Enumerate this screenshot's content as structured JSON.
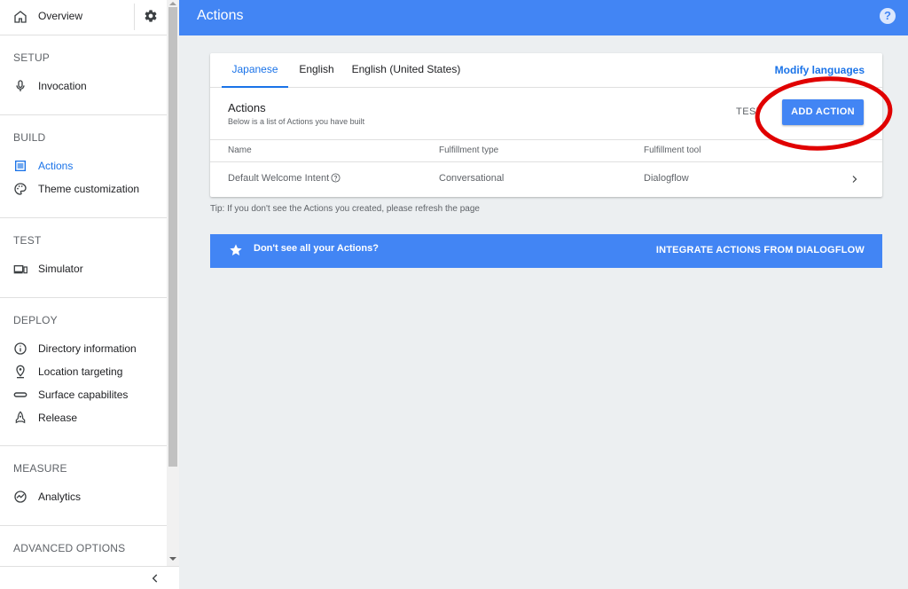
{
  "header": {
    "title": "Actions",
    "help_glyph": "?"
  },
  "sidebar": {
    "overview": {
      "label": "Overview",
      "icon": "home-icon",
      "settings_icon": "gear-icon"
    },
    "sections": [
      {
        "title": "SETUP",
        "items": [
          {
            "label": "Invocation",
            "icon": "mic-icon"
          }
        ]
      },
      {
        "title": "BUILD",
        "items": [
          {
            "label": "Actions",
            "icon": "list-icon",
            "active": true
          },
          {
            "label": "Theme customization",
            "icon": "palette-icon"
          }
        ]
      },
      {
        "title": "TEST",
        "items": [
          {
            "label": "Simulator",
            "icon": "devices-icon"
          }
        ]
      },
      {
        "title": "DEPLOY",
        "items": [
          {
            "label": "Directory information",
            "icon": "info-icon"
          },
          {
            "label": "Location targeting",
            "icon": "location-pin-icon"
          },
          {
            "label": "Surface capabilites",
            "icon": "surface-icon"
          },
          {
            "label": "Release",
            "icon": "rocket-icon"
          }
        ]
      },
      {
        "title": "MEASURE",
        "items": [
          {
            "label": "Analytics",
            "icon": "analytics-icon"
          }
        ]
      },
      {
        "title": "ADVANCED OPTIONS",
        "items": []
      }
    ],
    "collapse_icon": "chevron-left-icon"
  },
  "tabs": [
    {
      "label": "Japanese",
      "active": true
    },
    {
      "label": "English"
    },
    {
      "label": "English (United States)"
    }
  ],
  "modify_languages": "Modify languages",
  "actions_list": {
    "title": "Actions",
    "subtitle": "Below is a list of Actions you have built",
    "test_label": "TEST",
    "add_label": "ADD ACTION",
    "columns": [
      "Name",
      "Fulfillment type",
      "Fulfillment tool"
    ],
    "rows": [
      {
        "name": "Default Welcome Intent",
        "type": "Conversational",
        "tool": "Dialogflow"
      }
    ]
  },
  "tip": "Tip: If you don't see the Actions you created, please refresh the page",
  "banner": {
    "message": "Don't see all your Actions?",
    "action": "INTEGRATE ACTIONS FROM DIALOGFLOW"
  },
  "colors": {
    "primary": "#4285f4",
    "link": "#1a73e8",
    "annotation": "#e00000"
  }
}
